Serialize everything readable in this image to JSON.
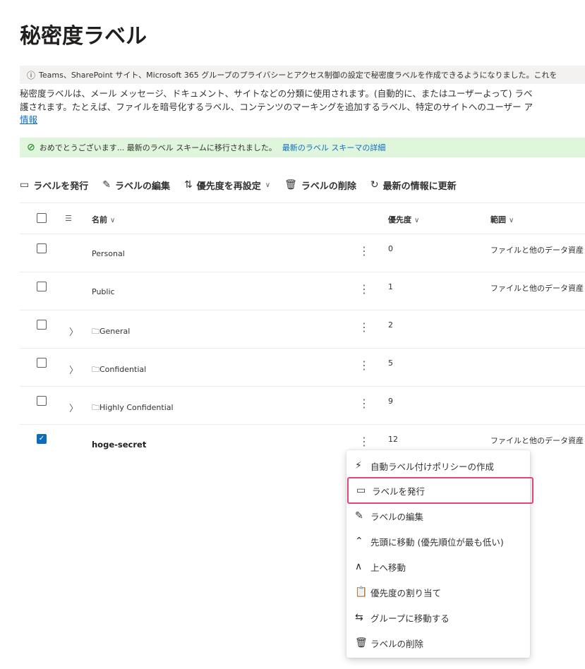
{
  "page": {
    "title": "秘密度ラベル",
    "info_text": "Teams、SharePoint サイト、Microsoft 365 グループのプライバシーとアクセス制御の設定で秘密度ラベルを作成できるようになりました。これを",
    "description_line1": "秘密度ラベルは、メール メッセージ、ドキュメント、サイトなどの分類に使用されます。(自動的に、またはユーザーよって) ラベ",
    "description_line2": "護されます。たとえば、ファイルを暗号化するラベル、コンテンツのマーキングを追加するラベル、特定のサイトへのユーザー ア",
    "description_link": "情報",
    "success_text": "おめでとうございます... 最新のラベル スキームに移行されました。",
    "success_link": "最新のラベル スキーマの詳細"
  },
  "toolbar": {
    "publish": "ラベルを発行",
    "edit": "ラベルの編集",
    "reorder": "優先度を再設定",
    "delete": "ラベルの削除",
    "refresh": "最新の情報に更新"
  },
  "table": {
    "headers": {
      "name": "名前",
      "priority": "優先度",
      "scope": "範囲"
    },
    "rows": [
      {
        "name": "Personal",
        "priority": "0",
        "scope": "ファイルと他のデータ資産",
        "group": false,
        "checked": false
      },
      {
        "name": "Public",
        "priority": "1",
        "scope": "ファイルと他のデータ資産",
        "group": false,
        "checked": false
      },
      {
        "name": "General",
        "priority": "2",
        "scope": "",
        "group": true,
        "checked": false
      },
      {
        "name": "Confidential",
        "priority": "5",
        "scope": "",
        "group": true,
        "checked": false
      },
      {
        "name": "Highly Confidential",
        "priority": "9",
        "scope": "",
        "group": true,
        "checked": false
      },
      {
        "name": "hoge-secret",
        "priority": "12",
        "scope": "ファイルと他のデータ資産",
        "group": false,
        "checked": true
      }
    ]
  },
  "context_menu": {
    "items": [
      {
        "label": "自動ラベル付けポリシーの作成",
        "icon": "auto-label-icon"
      },
      {
        "label": "ラベルを発行",
        "icon": "publish-icon"
      },
      {
        "label": "ラベルの編集",
        "icon": "pencil-icon"
      },
      {
        "label": "先頭に移動 (優先順位が最も低い)",
        "icon": "move-to-top-icon"
      },
      {
        "label": "上へ移動",
        "icon": "chevron-up-icon"
      },
      {
        "label": "優先度の割り当て",
        "icon": "clipboard-icon"
      },
      {
        "label": "グループに移動する",
        "icon": "move-group-icon"
      },
      {
        "label": "ラベルの削除",
        "icon": "trash-icon"
      }
    ]
  },
  "colors": {
    "accent": "#0f6cbd",
    "highlight": "#e3447d",
    "success_bg": "#dff6dd",
    "info_bg": "#f3f2f1"
  }
}
